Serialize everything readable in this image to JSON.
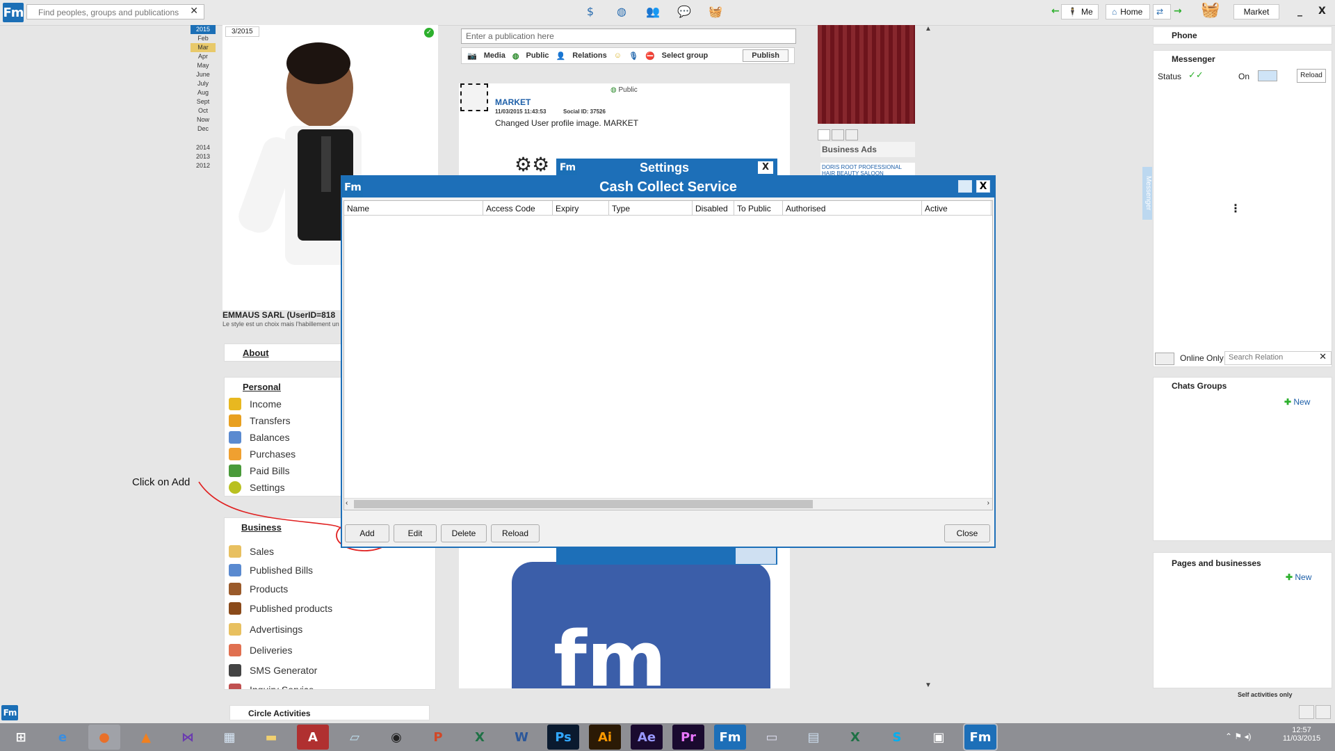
{
  "topbar": {
    "search_placeholder": "Find peoples, groups and publications",
    "me_label": "Me",
    "home_label": "Home",
    "market_label": "Market",
    "minimize_label": "_",
    "close_label": "X"
  },
  "calendar": {
    "months": [
      "Feb",
      "Mar",
      "Apr",
      "May",
      "June",
      "July",
      "Aug",
      "Sept",
      "Oct",
      "Now",
      "Dec"
    ],
    "years": [
      "2014",
      "2013",
      "2012"
    ],
    "current_year": "2015",
    "current_period": "3/2015"
  },
  "profile": {
    "name": "EMMAUS SARL (UserID=818",
    "tagline": "Le style est un choix mais l'habillement un"
  },
  "menu": {
    "about_label": "About",
    "personal_title": "Personal",
    "personal_items": [
      "Income",
      "Transfers",
      "Balances",
      "Purchases",
      "Paid Bills",
      "Settings"
    ],
    "business_title": "Business",
    "business_items": [
      "Sales",
      "Published Bills",
      "Products",
      "Published products",
      "Advertisings",
      "Deliveries",
      "SMS Generator",
      "Inquiry Service"
    ]
  },
  "annotation": {
    "text": "Click on Add"
  },
  "publish_bar": {
    "placeholder": "Enter a publication here",
    "media": "Media",
    "public": "Public",
    "relations": "Relations",
    "select_group": "Select group",
    "publish": "Publish"
  },
  "post": {
    "visibility": "Public",
    "author": "MARKET",
    "date": "11/03/2015 11:43:53",
    "social_id": "Social ID: 37526",
    "message": "Changed User profile image. MARKET"
  },
  "ads": {
    "title": "Business Ads",
    "ad_text": "DORIS ROOT PROFESSIONAL HAIR BEAUTY SALOON"
  },
  "settings_window": {
    "title": "Settings",
    "close": "X"
  },
  "dialog": {
    "title": "Cash Collect Service",
    "close": "X",
    "columns": [
      "Name",
      "Access Code",
      "Expiry",
      "Type",
      "Disabled",
      "To Public",
      "Authorised",
      "Active"
    ],
    "buttons": {
      "add": "Add",
      "edit": "Edit",
      "delete": "Delete",
      "reload": "Reload",
      "close": "Close"
    }
  },
  "sidebar_right": {
    "phone": "Phone",
    "messenger": "Messenger",
    "status_label": "Status",
    "on_label": "On",
    "reload": "Reload",
    "online_only": "Online Only",
    "search_relation_placeholder": "Search Relation",
    "messenger_tab": "Messenger",
    "chats_groups": "Chats Groups",
    "new_label": "New",
    "pages_businesses": "Pages and businesses",
    "new_label2": "New",
    "self_activities": "Self activities only"
  },
  "footer": {
    "circle_activities": "Circle Activities"
  },
  "taskbar": {
    "apps": [
      "windows",
      "internet-explorer",
      "firefox",
      "vlc",
      "visual-studio",
      "calculator",
      "file-explorer",
      "acrobat",
      "notepad",
      "camera",
      "powerpoint",
      "excel",
      "word",
      "photoshop",
      "illustrator",
      "after-effects",
      "premiere",
      "fm-app",
      "network",
      "photo-viewer",
      "excel-2",
      "skype",
      "window-app",
      "fm-app-2"
    ],
    "time": "12:57",
    "date": "11/03/2015"
  },
  "colors": {
    "brand_blue": "#1d6fb8",
    "annotation_red": "#e02020",
    "green": "#2db02d"
  }
}
